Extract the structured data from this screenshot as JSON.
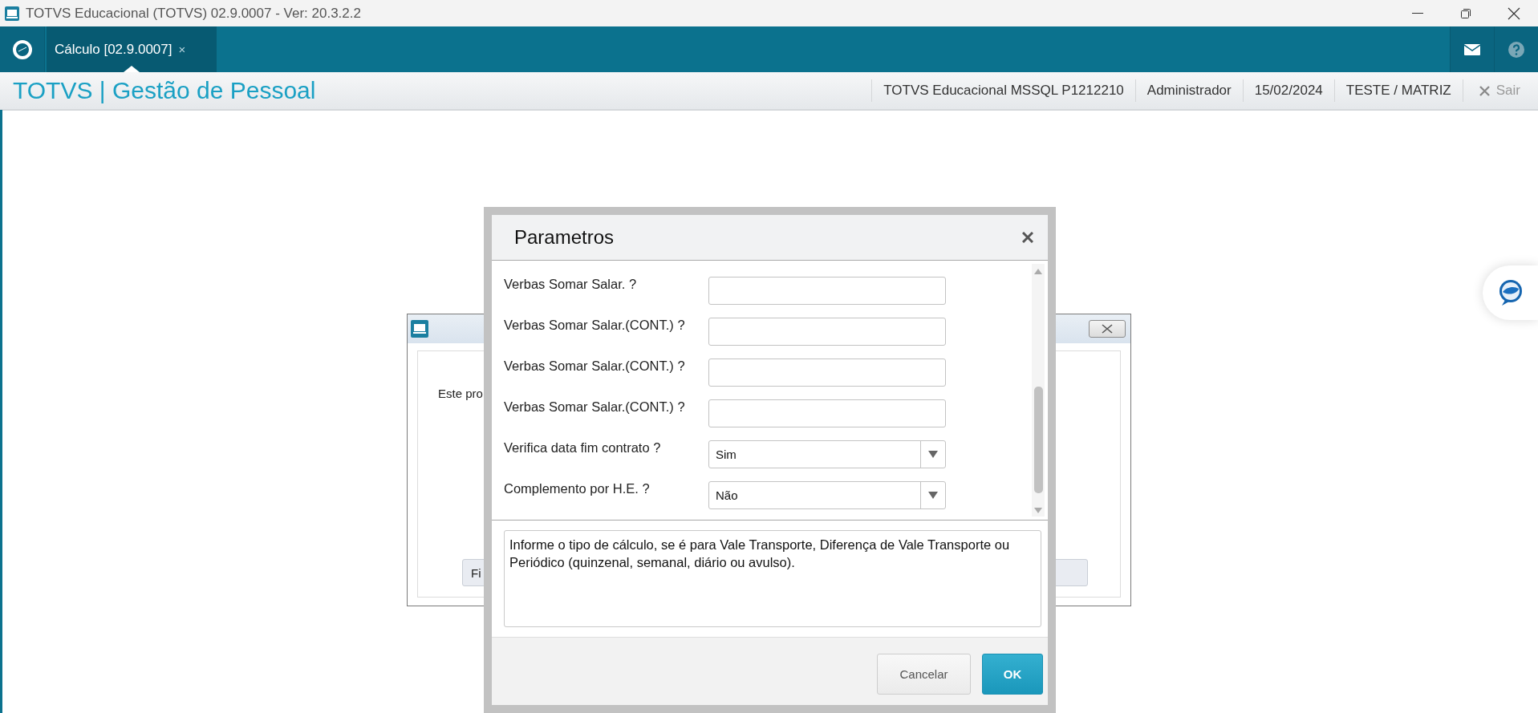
{
  "window": {
    "title": "TOTVS Educacional (TOTVS) 02.9.0007 - Ver: 20.3.2.2"
  },
  "tabs": [
    {
      "label": "Cálculo [02.9.0007]",
      "close": "×",
      "selected": true
    }
  ],
  "header": {
    "title": "TOTVS | Gestão de Pessoal",
    "info": [
      "TOTVS Educacional MSSQL P1212210",
      "Administrador",
      "15/02/2024",
      "TESTE / MATRIZ"
    ],
    "exit": "Sair"
  },
  "background_dialog": {
    "text": "Este pro",
    "button": "Fi"
  },
  "dialog": {
    "title": "Parametros",
    "fields": [
      {
        "label": "Verbas Somar Salar. ?",
        "kind": "text"
      },
      {
        "label": "Verbas Somar Salar.(CONT.) ?",
        "kind": "text"
      },
      {
        "label": "Verbas Somar Salar.(CONT.) ?",
        "kind": "text"
      },
      {
        "label": "Verbas Somar Salar.(CONT.) ?",
        "kind": "text"
      },
      {
        "label": "Verifica data fim contrato ?",
        "kind": "select",
        "value": "Sim"
      },
      {
        "label": "Complemento por H.E. ?",
        "kind": "select",
        "value": "Não"
      }
    ],
    "description": "Informe o tipo de cálculo, se é para Vale Transporte, Diferença de Vale Transporte ou Periódico (quinzenal, semanal, diário ou avulso).",
    "buttons": [
      {
        "label": "Cancelar",
        "kind": "secondary"
      },
      {
        "label": "OK",
        "kind": "primary"
      }
    ]
  }
}
